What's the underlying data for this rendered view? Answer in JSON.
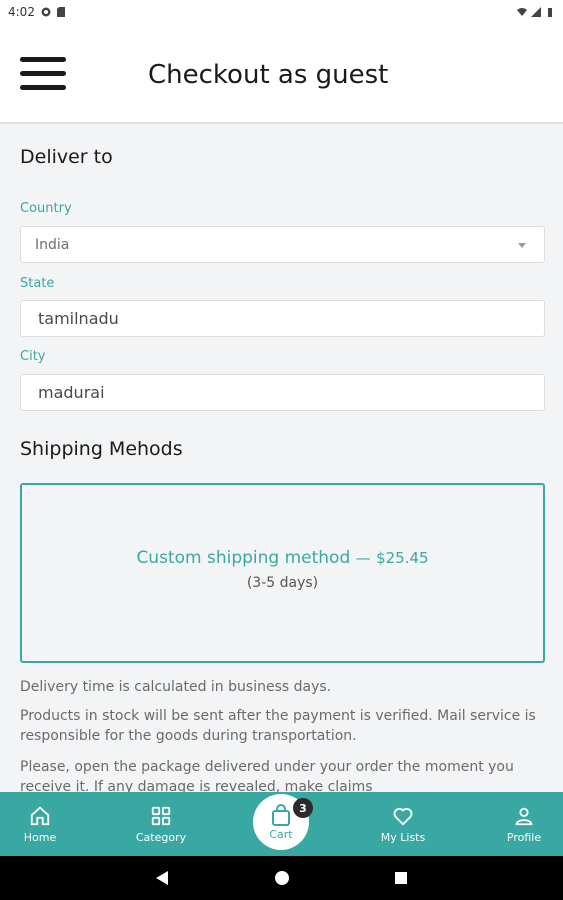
{
  "status_bar": {
    "time": "4:02"
  },
  "header": {
    "title": "Checkout as guest"
  },
  "deliver": {
    "section_title": "Deliver to",
    "country_label": "Country",
    "country_value": "India",
    "state_label": "State",
    "state_value": "tamilnadu",
    "city_label": "City",
    "city_value": "madurai"
  },
  "shipping": {
    "section_title": "Shipping Mehods",
    "method_name": "Custom shipping method",
    "method_separator": "—",
    "method_price": "$25.45",
    "method_days": "(3-5 days)"
  },
  "notes": {
    "line1": "Delivery time is calculated in business days.",
    "line2": "Products in stock will be sent after the payment is verified. Mail service is responsible for the goods during transportation.",
    "line3": "Please, open the package delivered under your order the moment you receive it. If any damage is revealed, make claims"
  },
  "bottom_nav": {
    "home": "Home",
    "category": "Category",
    "cart": "Cart",
    "cart_count": "3",
    "my_lists": "My Lists",
    "profile": "Profile"
  },
  "colors": {
    "accent": "#3aa8a2",
    "background": "#f3f4f6"
  }
}
